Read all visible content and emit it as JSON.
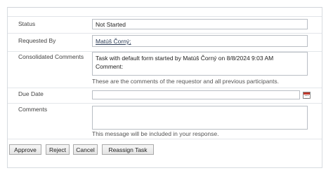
{
  "form": {
    "status_label": "Status",
    "status_value": "Not Started",
    "requested_by_label": "Requested By",
    "requested_by_value": "Matúš Čorný;",
    "consolidated_label": "Consolidated Comments",
    "consolidated_line1": "Task with default form started by Matúš Čorný on 8/8/2024 9:03 AM",
    "consolidated_line2": "Comment:",
    "consolidated_hint": "These are the comments of the requestor and all previous participants.",
    "due_date_label": "Due Date",
    "due_date_value": "",
    "comments_label": "Comments",
    "comments_value": "",
    "comments_hint": "This message will be included in your response."
  },
  "buttons": {
    "approve": "Approve",
    "reject": "Reject",
    "cancel": "Cancel",
    "reassign": "Reassign Task"
  },
  "icons": {
    "calendar": "calendar-icon"
  }
}
